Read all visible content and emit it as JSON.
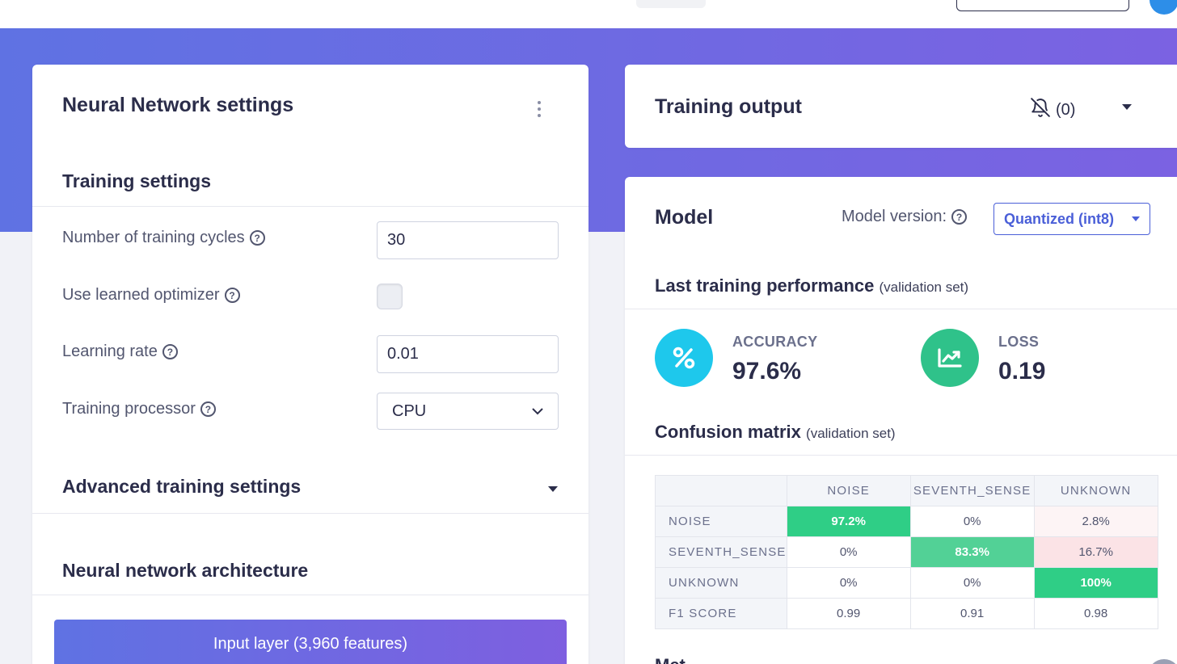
{
  "nn_settings": {
    "title": "Neural Network settings",
    "training_settings_title": "Training settings",
    "fields": {
      "training_cycles": {
        "label": "Number of training cycles",
        "value": "30"
      },
      "learned_optimizer": {
        "label": "Use learned optimizer",
        "checked": false
      },
      "learning_rate": {
        "label": "Learning rate",
        "value": "0.01"
      },
      "training_processor": {
        "label": "Training processor",
        "value": "CPU"
      }
    },
    "advanced_title": "Advanced training settings",
    "architecture_title": "Neural network architecture",
    "input_layer_label": "Input layer (3,960 features)"
  },
  "training_output": {
    "title": "Training output",
    "notification_count": "(0)"
  },
  "model": {
    "title": "Model",
    "version_label": "Model version:",
    "version_value": "Quantized (int8)",
    "performance_title": "Last training performance",
    "performance_subtitle": "(validation set)",
    "accuracy": {
      "label": "ACCURACY",
      "value": "97.6%"
    },
    "loss": {
      "label": "LOSS",
      "value": "0.19"
    },
    "confusion_title": "Confusion matrix",
    "confusion_subtitle": "(validation set)",
    "confusion_matrix": {
      "columns": [
        "NOISE",
        "SEVENTH_SENSE",
        "UNKNOWN"
      ],
      "rows": [
        {
          "label": "NOISE",
          "cells": [
            "97.2%",
            "0%",
            "2.8%"
          ]
        },
        {
          "label": "SEVENTH_SENSE",
          "cells": [
            "0%",
            "83.3%",
            "16.7%"
          ]
        },
        {
          "label": "UNKNOWN",
          "cells": [
            "0%",
            "0%",
            "100%"
          ]
        },
        {
          "label": "F1 SCORE",
          "cells": [
            "0.99",
            "0.91",
            "0.98"
          ]
        }
      ]
    },
    "next_section_partial": "Met"
  },
  "colors": {
    "banner_start": "#5f72e3",
    "banner_end": "#7b62e2",
    "accuracy_icon": "#1ec8ec",
    "loss_icon": "#2fc28a",
    "cell_strong": "#2fce86",
    "cell_medium": "#52d196",
    "cell_light_red": "#fbe3e6",
    "cell_faint_red": "#fdf4f5",
    "accent": "#4a5fd8"
  },
  "icons": {
    "help": "question-circle-icon",
    "bell": "bell-slash-icon",
    "accuracy": "percent-icon",
    "loss": "chart-line-icon",
    "more": "kebab-menu-icon"
  }
}
